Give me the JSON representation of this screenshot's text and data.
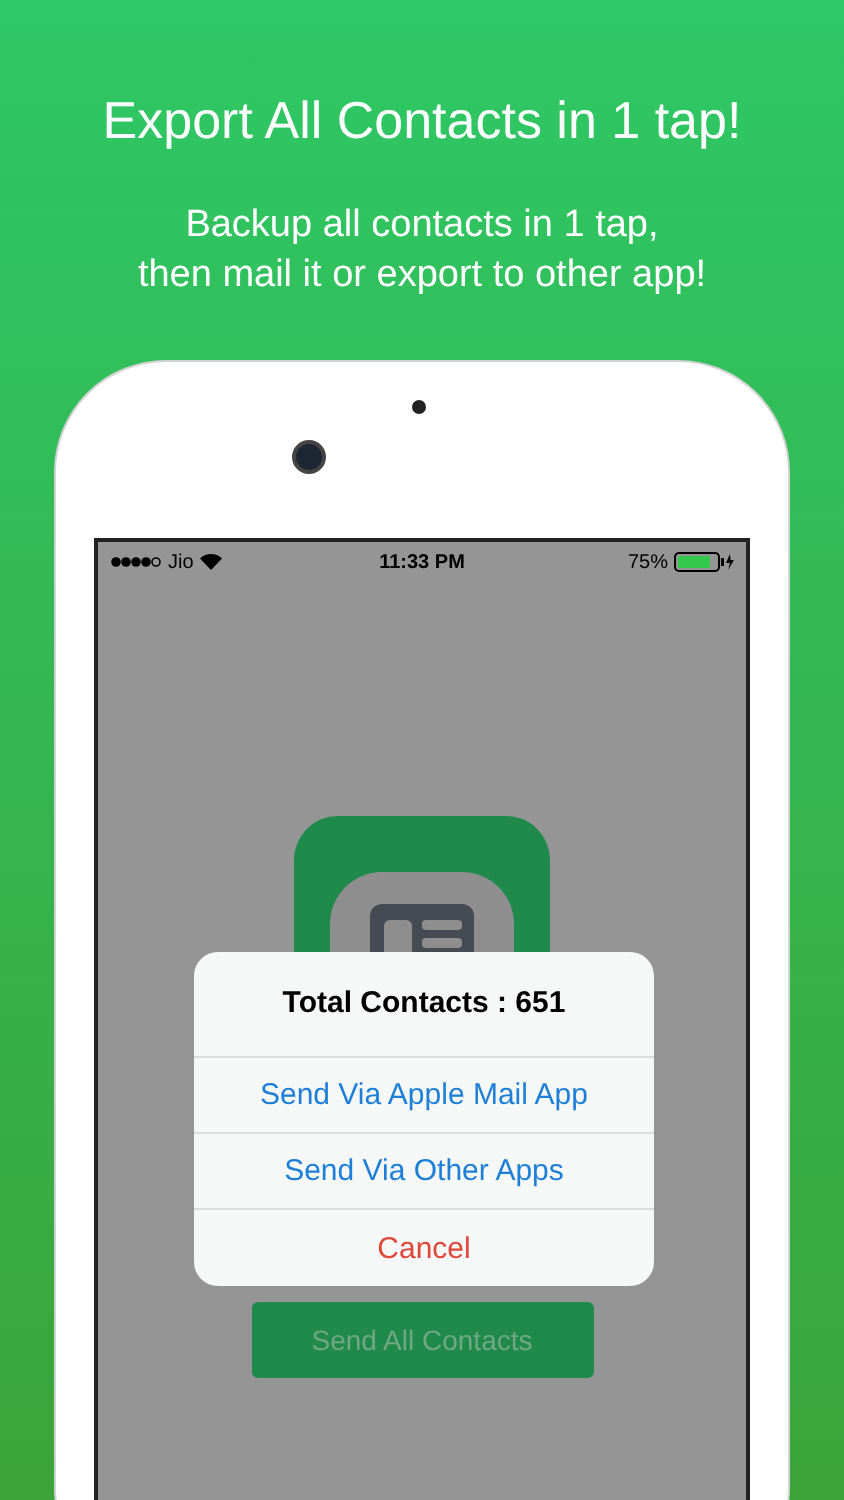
{
  "headline": "Export All Contacts in 1 tap!",
  "subtitle": "Backup all contacts in 1 tap,\nthen mail it or export to other app!",
  "status_bar": {
    "carrier": "Jio",
    "time": "11:33 PM",
    "battery": "75%"
  },
  "alert": {
    "title": "Total Contacts : 651",
    "actions": [
      {
        "label": "Send Via Apple Mail App",
        "kind": "default"
      },
      {
        "label": "Send Via Other Apps",
        "kind": "default"
      },
      {
        "label": "Cancel",
        "kind": "destructive"
      }
    ]
  },
  "main_button": {
    "label": "Send All Contacts"
  }
}
